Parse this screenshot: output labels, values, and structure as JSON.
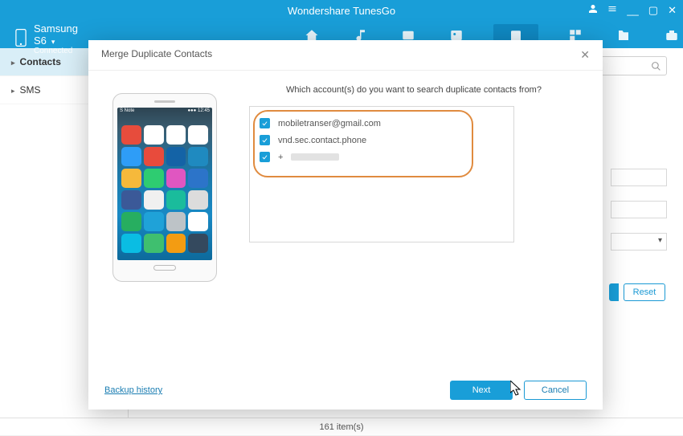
{
  "titlebar": {
    "title": "Wondershare TunesGo"
  },
  "device": {
    "name": "Samsung S6",
    "status": "Connected"
  },
  "sidebar": {
    "items": [
      {
        "label": "Contacts",
        "active": true
      },
      {
        "label": "SMS",
        "active": false
      }
    ]
  },
  "content": {
    "buttons": {
      "reset": "Reset"
    }
  },
  "statusbar": {
    "text": "161 item(s)"
  },
  "modal": {
    "title": "Merge Duplicate Contacts",
    "question": "Which account(s) do you want to search duplicate contacts from?",
    "accounts": [
      {
        "label": "mobiletranser@gmail.com",
        "checked": true
      },
      {
        "label": "vnd.sec.contact.phone",
        "checked": true
      },
      {
        "label": "+",
        "checked": true,
        "redacted": true
      }
    ],
    "history_link": "Backup history",
    "next": "Next",
    "cancel": "Cancel"
  }
}
